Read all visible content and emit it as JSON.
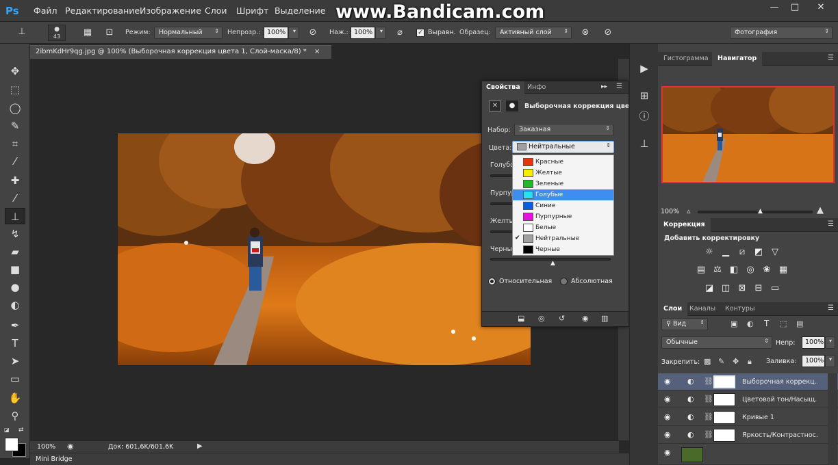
{
  "app": {
    "logo": "Ps",
    "watermark": "www.Bandicam.com"
  },
  "menu": [
    "Файл",
    "Редактирование",
    "Изображение",
    "Слои",
    "Шрифт",
    "Выделение"
  ],
  "window_controls": {
    "minimize": "—",
    "maximize": "□",
    "close": "✕"
  },
  "options": {
    "brush_size": "43",
    "mode_label": "Режим:",
    "mode_value": "Нормальный",
    "opacity_label": "Непрозр.:",
    "opacity_value": "100%",
    "pressure_label": "Наж.:",
    "pressure_value": "100%",
    "align_label": "Выравн.",
    "sample_label": "Образец:",
    "sample_value": "Активный слой",
    "workspace": "Фотография"
  },
  "document": {
    "tab_title": "2ibmKdHr9qg.jpg @ 100% (Выборочная коррекция цвета 1, Слой-маска/8) *",
    "tab_close": "×",
    "zoom": "100%",
    "doc_info": "Док: 601,6K/601,6K",
    "mini_bridge": "Mini Bridge"
  },
  "properties": {
    "tabs": [
      "Свойства",
      "Инфо"
    ],
    "title": "Выборочная коррекция цвета",
    "preset_label": "Набор:",
    "preset_value": "Заказная",
    "colors_label": "Цвета:",
    "colors_value": "Нейтральные",
    "sliders": [
      "Голубой",
      "Пурпурный",
      "Желтый",
      "Черный"
    ],
    "radio_relative": "Относительная",
    "radio_absolute": "Абсолютная",
    "color_options": [
      {
        "label": "Красные",
        "color": "#e8340c"
      },
      {
        "label": "Желтые",
        "color": "#f4f000"
      },
      {
        "label": "Зеленые",
        "color": "#22b82a"
      },
      {
        "label": "Голубые",
        "color": "#28e0f4"
      },
      {
        "label": "Синие",
        "color": "#0a5ce0"
      },
      {
        "label": "Пурпурные",
        "color": "#e810e0"
      },
      {
        "label": "Белые",
        "color": "#ffffff"
      },
      {
        "label": "Нейтральные",
        "color": "#a0a0a0"
      },
      {
        "label": "Черные",
        "color": "#000000"
      }
    ],
    "checked_option": "Нейтральные",
    "highlighted_option": "Голубые"
  },
  "navigator": {
    "tabs": [
      "Гистограмма",
      "Навигатор"
    ],
    "zoom": "100%"
  },
  "adjustments": {
    "tab": "Коррекция",
    "heading": "Добавить корректировку"
  },
  "layers": {
    "tabs": [
      "Слои",
      "Каналы",
      "Контуры"
    ],
    "filter_kind": "Вид",
    "blend_mode": "Обычные",
    "opacity_label": "Непр:",
    "opacity_value": "100%",
    "lock_label": "Закрепить:",
    "fill_label": "Заливка:",
    "fill_value": "100%",
    "rows": [
      {
        "name": "Выборочная коррекц...",
        "selected": true
      },
      {
        "name": "Цветовой тон/Насыщ...",
        "selected": false
      },
      {
        "name": "Кривые 1",
        "selected": false
      },
      {
        "name": "Яркость/Контрастнос...",
        "selected": false
      }
    ]
  },
  "colors": {
    "accent": "#3e8ef0",
    "ps_blue": "#31a8ff",
    "panel": "#434343"
  }
}
